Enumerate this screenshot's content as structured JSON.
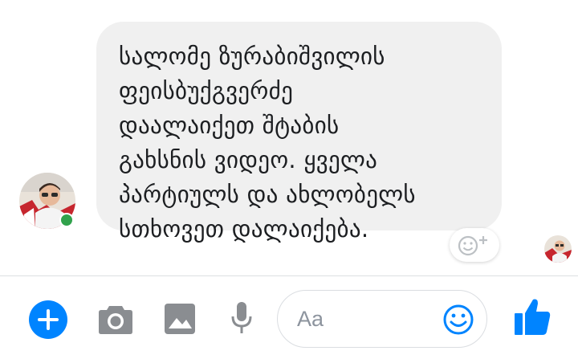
{
  "conversation": {
    "message_text": "სალომე ზურაბიშვილის\nფეისბუქგვერძე\nდაალაიქეთ შტაბის\nგახსნის ვიდეო. ყველა\nპარტიულს და ახლობელს\nსთხოვეთ დალაიქება.",
    "sender_online": true
  },
  "composer": {
    "placeholder": "Aa"
  },
  "icons": {
    "add": "plus-circle-icon",
    "camera": "camera-icon",
    "image": "image-icon",
    "mic": "microphone-icon",
    "emoji": "smiley-icon",
    "like": "thumbs-up-icon",
    "reaction": "add-reaction-icon"
  },
  "colors": {
    "accent": "#0084ff",
    "tool_gray": "#8a8d91",
    "bubble_bg": "#f0f0f0",
    "online": "#31a24c"
  }
}
